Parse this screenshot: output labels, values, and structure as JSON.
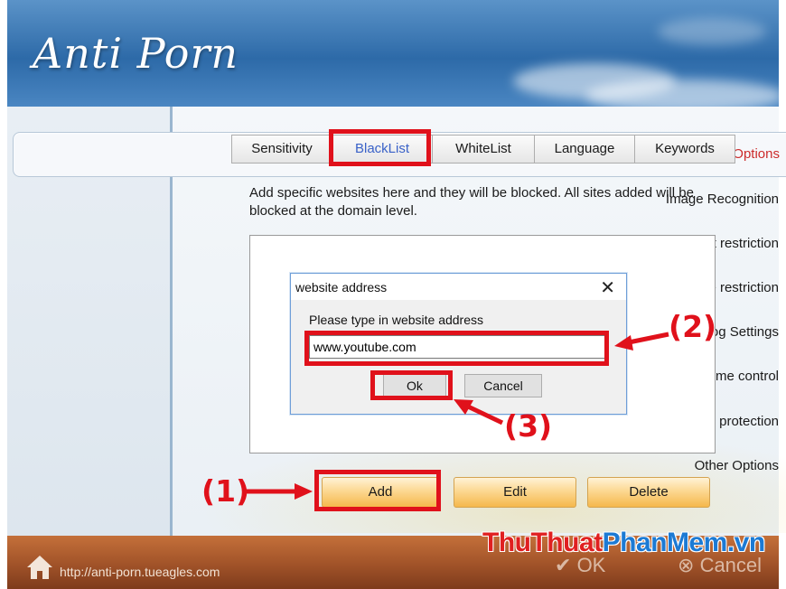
{
  "app": {
    "title": "Anti Porn"
  },
  "sidebar": {
    "items": [
      {
        "label": "Filter Options",
        "active": true
      },
      {
        "label": "Image Recognition"
      },
      {
        "label": "Chat restriction"
      },
      {
        "label": "Game restriction"
      },
      {
        "label": "Log Settings"
      },
      {
        "label": "Time control"
      },
      {
        "label": "Eye protection"
      },
      {
        "label": "Other Options"
      }
    ]
  },
  "tabs": [
    {
      "label": "Sensitivity"
    },
    {
      "label": "BlackList",
      "active": true
    },
    {
      "label": "WhiteList"
    },
    {
      "label": "Language"
    },
    {
      "label": "Keywords"
    }
  ],
  "blacklist": {
    "description": "Add specific websites here and they will be blocked. All sites added will be blocked at the domain level."
  },
  "dialog": {
    "title": "website address",
    "close": "✕",
    "prompt": "Please type in website address",
    "input_value": "www.youtube.com",
    "ok_label": "Ok",
    "cancel_label": "Cancel"
  },
  "actions": {
    "add_label": "Add",
    "edit_label": "Edit",
    "delete_label": "Delete"
  },
  "footer": {
    "url": "http://anti-porn.tueagles.com",
    "ok_label": "OK",
    "cancel_label": "Cancel",
    "ok_icon": "check-circle-icon",
    "cancel_icon": "x-circle-icon",
    "home_icon": "home-icon"
  },
  "watermark": {
    "part1": "ThuThuat",
    "part2": "PhanMem",
    "part3": ".vn"
  },
  "annotations": {
    "step1": "(1)",
    "step2": "(2)",
    "step3": "(3)",
    "color": "#e0111b"
  },
  "colors": {
    "accent_red": "#cc2b2b",
    "tab_active": "#3a62c8",
    "button_orange": "#f5b84c"
  }
}
